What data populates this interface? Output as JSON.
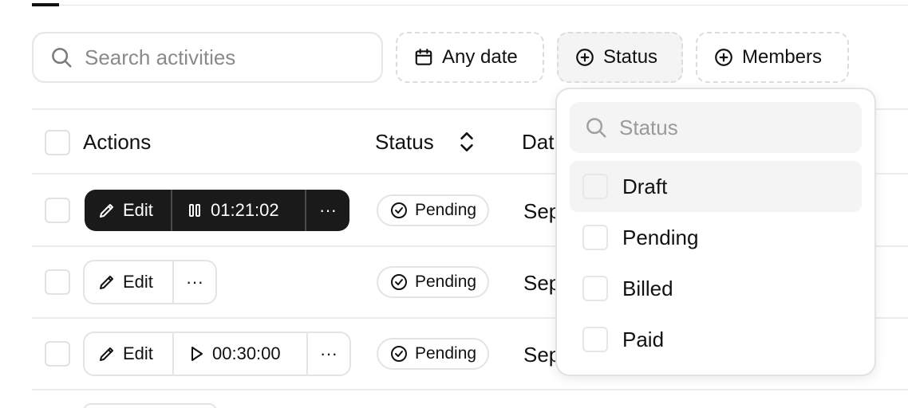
{
  "search": {
    "placeholder": "Search activities",
    "icon": "search-icon"
  },
  "filters": {
    "date_label": "Any date",
    "status_label": "Status",
    "members_label": "Members"
  },
  "table": {
    "headers": {
      "actions": "Actions",
      "status": "Status",
      "date": "Dat"
    },
    "rows": [
      {
        "edit_label": "Edit",
        "timer_label": "01:21:02",
        "timer_state": "running",
        "more_label": "···",
        "status": "Pending",
        "date": "Sep"
      },
      {
        "edit_label": "Edit",
        "more_label": "···",
        "status": "Pending",
        "date": "Sep"
      },
      {
        "edit_label": "Edit",
        "timer_label": "00:30:00",
        "timer_state": "paused",
        "more_label": "···",
        "status": "Pending",
        "date": "Sep"
      }
    ]
  },
  "status_dropdown": {
    "search_placeholder": "Status",
    "options": [
      "Draft",
      "Pending",
      "Billed",
      "Paid"
    ]
  },
  "colors": {
    "dark_button": "#1a1a1a",
    "border": "#e4e4e4",
    "hover": "#f4f4f4"
  }
}
